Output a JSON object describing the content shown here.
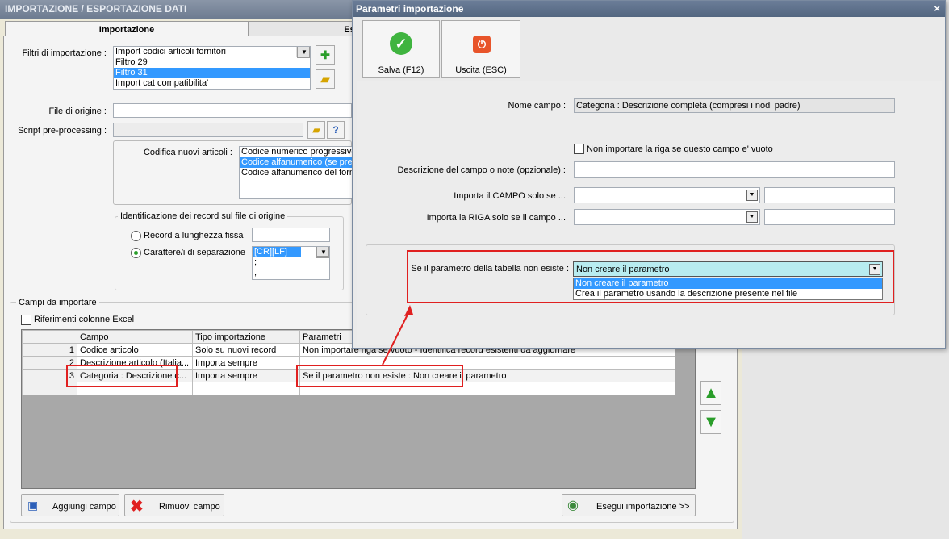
{
  "window": {
    "title": "IMPORTAZIONE / ESPORTAZIONE DATI"
  },
  "tabs": [
    {
      "label": "Importazione"
    },
    {
      "label": "Es"
    }
  ],
  "filters": {
    "label": "Filtri di importazione :",
    "items": [
      "Import codici articoli fornitori",
      "Filtro 29",
      "Filtro 31",
      "Import cat compatibilita'"
    ],
    "selected_index": 2
  },
  "source_file": {
    "label": "File di origine :",
    "value": ""
  },
  "script_pre": {
    "label": "Script pre-processing :",
    "value": ""
  },
  "encoding": {
    "label": "Codifica nuovi articoli :",
    "items": [
      "Codice numerico progressivo",
      "Codice alfanumerico (se pres",
      "Codice alfanumerico del forni"
    ],
    "selected_index": 1
  },
  "record_id": {
    "title": "Identificazione dei record sul file di origine",
    "fixed_length_label": "Record a lunghezza fissa",
    "separator_label": "Carattere/i di separazione",
    "separator_items": [
      "[CR][LF]",
      ";",
      ","
    ]
  },
  "fields": {
    "title": "Campi da importare",
    "excel_refs_label": "Riferimenti colonne Excel",
    "columns": [
      "Campo",
      "Tipo importazione",
      "Parametri"
    ],
    "rows": [
      {
        "num": "1",
        "campo": "Codice articolo",
        "tipo": "Solo su nuovi record",
        "parametri": "Non importare riga se vuoto - Identifica record esistenti da aggiornare"
      },
      {
        "num": "2",
        "campo": "Descrizione articolo (Italia...",
        "tipo": "Importa sempre",
        "parametri": ""
      },
      {
        "num": "3",
        "campo": "Categoria : Descrizione c...",
        "tipo": "Importa sempre",
        "parametri": "Se il parametro non esiste : Non creare il parametro"
      }
    ]
  },
  "buttons": {
    "add_field": "Aggiungi campo",
    "remove_field": "Rimuovi campo",
    "run_import": "Esegui importazione >>"
  },
  "dialog": {
    "title": "Parametri importazione",
    "close": "×",
    "save_label": "Salva (F12)",
    "exit_label": "Uscita (ESC)",
    "field_name_label": "Nome campo :",
    "field_name_value": "Categoria : Descrizione completa (compresi i nodi padre)",
    "skip_empty_label": "Non importare la riga se questo campo e' vuoto",
    "description_label": "Descrizione del campo o note (opzionale) :",
    "import_field_if_label": "Importa il CAMPO solo se ...",
    "import_row_if_label": "Importa la RIGA solo se il campo ...",
    "param_missing_label": "Se il parametro della tabella non esiste :",
    "param_missing_value": "Non creare il parametro",
    "param_missing_options": [
      "Non creare il parametro",
      "Crea il parametro usando la descrizione presente nel file"
    ],
    "param_missing_selected": 0
  },
  "colors": {
    "highlight": "#e02020",
    "selection": "#3399ff",
    "combo_highlight": "#b8ecf0"
  }
}
